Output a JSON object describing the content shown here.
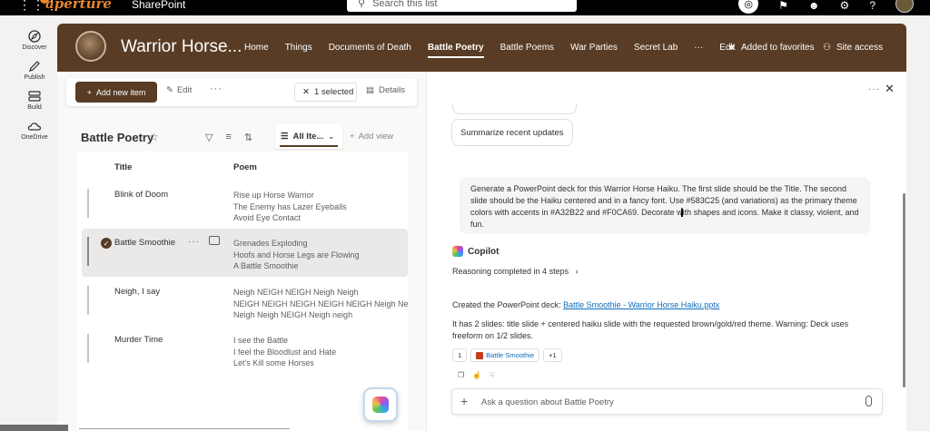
{
  "topbar": {
    "brand": "aperture",
    "app_name": "SharePoint",
    "search_placeholder": "Search this list"
  },
  "rail": {
    "items": [
      {
        "label": "Discover",
        "icon": "discover-icon"
      },
      {
        "label": "Publish",
        "icon": "publish-icon"
      },
      {
        "label": "Build",
        "icon": "build-icon"
      },
      {
        "label": "OneDrive",
        "icon": "onedrive-icon"
      }
    ]
  },
  "site": {
    "title": "Warrior Horse...",
    "nav": [
      "Home",
      "Things",
      "Documents of Death",
      "Battle Poetry",
      "Battle Poems",
      "War Parties",
      "Secret Lab",
      "···",
      "Edit"
    ],
    "active_nav": "Battle Poetry",
    "favorites_label": "Added to favorites",
    "site_access_label": "Site access",
    "header_color": "#583C25"
  },
  "commandbar": {
    "add_label": "Add new item",
    "edit_label": "Edit",
    "more_label": "···",
    "selected_label": "1 selected",
    "details_label": "Details"
  },
  "list": {
    "title": "Battle Poetry",
    "view_label": "All Ite...",
    "add_view_label": "Add view",
    "columns": {
      "title": "Title",
      "poem": "Poem"
    },
    "rows": [
      {
        "title": "Blink of Doom",
        "poem": [
          "Rise up Horse Warrior",
          "The Enemy has Lazer Eyeballs",
          "Avoid Eye Contact"
        ],
        "selected": false
      },
      {
        "title": "Battle Smoothie",
        "poem": [
          "Grenades Exploding",
          "Hoofs and Horse Legs are Flowing",
          "A Battle Smoothie"
        ],
        "selected": true
      },
      {
        "title": "Neigh, I say",
        "poem": [
          "Neigh NEIGH NEIGH Neigh Neigh",
          "NEIGH NEIGH NEIGH NEIGH NEIGH Neigh Neigh",
          "Neigh Neigh NEIGH Neigh neigh"
        ],
        "selected": false
      },
      {
        "title": "Murder Time",
        "poem": [
          "I see the Battle",
          "I feel the Bloodlust and Hate",
          "Let's Kill some Horses"
        ],
        "selected": false
      }
    ]
  },
  "chat": {
    "suggestion": "Summarize recent updates",
    "user_message": "Generate a PowerPoint deck for this Warrior Horse Haiku. The first slide should be the Title. The second slide should be the Haiku centered and in a fancy font. Use #583C25 (and variations) as the primary theme colors with accents in #A32B22 and #F0CA69. Decorate with shapes and icons. Make it classy, violent, and fun.",
    "assistant_name": "Copilot",
    "reasoning": "Reasoning completed in 4 steps",
    "response_prefix": "Created the PowerPoint deck: ",
    "response_link": "Battle Smoothie - Warrior Horse Haiku.pptx",
    "response_detail": "It has 2 slides: title slide + centered haiku slide with the requested brown/gold/red theme. Warning: Deck uses freeform on 1/2 slides.",
    "ref_index": "1",
    "ref_name": "Battle Smoothie",
    "ref_more": "+1",
    "input_placeholder": "Ask a question about Battle Poetry"
  }
}
